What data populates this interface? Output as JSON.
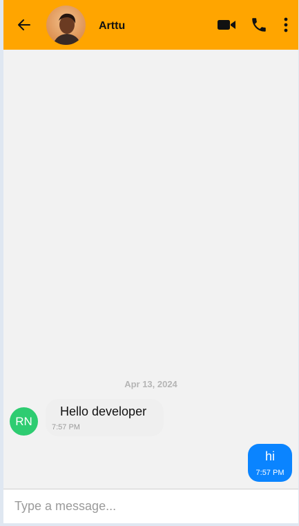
{
  "header": {
    "contact_name": "Arttu",
    "back_icon": "arrow-left-icon",
    "video_icon": "video-camera-icon",
    "phone_icon": "phone-icon",
    "more_icon": "more-vertical-icon",
    "background_color": "#ffa500"
  },
  "chat": {
    "date_separator": "Apr 13, 2024",
    "messages": [
      {
        "direction": "incoming",
        "sender_initials": "RN",
        "text": "Hello developer",
        "time": "7:57 PM",
        "avatar_color": "#2ecc71"
      },
      {
        "direction": "outgoing",
        "text": "hi",
        "time": "7:57 PM",
        "bubble_color": "#0a84ff"
      }
    ]
  },
  "composer": {
    "placeholder": "Type a message...",
    "value": ""
  }
}
